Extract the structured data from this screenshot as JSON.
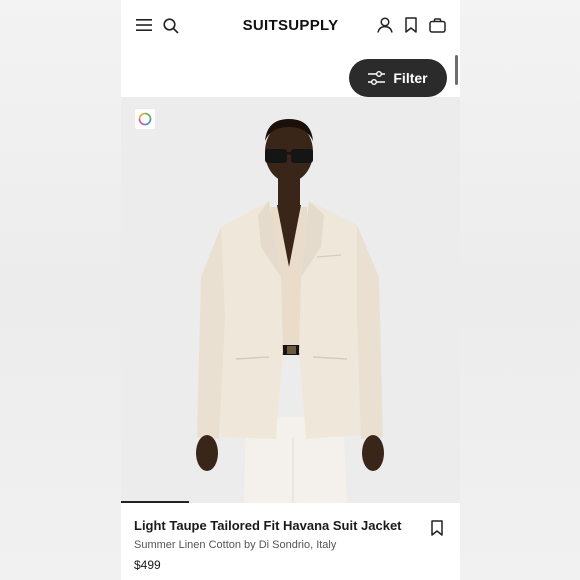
{
  "header": {
    "brand": "SUITSUPPLY",
    "menu_icon": "hamburger-menu-icon",
    "search_icon": "search-icon",
    "account_icon": "user-icon",
    "wishlist_icon": "bookmark-icon",
    "bag_icon": "shopping-bag-icon"
  },
  "filter": {
    "label": "Filter",
    "icon": "sliders-icon"
  },
  "product": {
    "title": "Light Taupe Tailored Fit Havana Suit Jacket",
    "subtitle": "Summer Linen Cotton by Di Sondrio, Italy",
    "price": "$499",
    "color_swatch_icon": "multicolor-ring-icon",
    "save_icon": "bookmark-icon",
    "image_progress": 0.2,
    "colors": {
      "suit": "#efe7da",
      "shirt": "#eadccb",
      "skin": "#3a2519",
      "background": "#ececec"
    }
  }
}
